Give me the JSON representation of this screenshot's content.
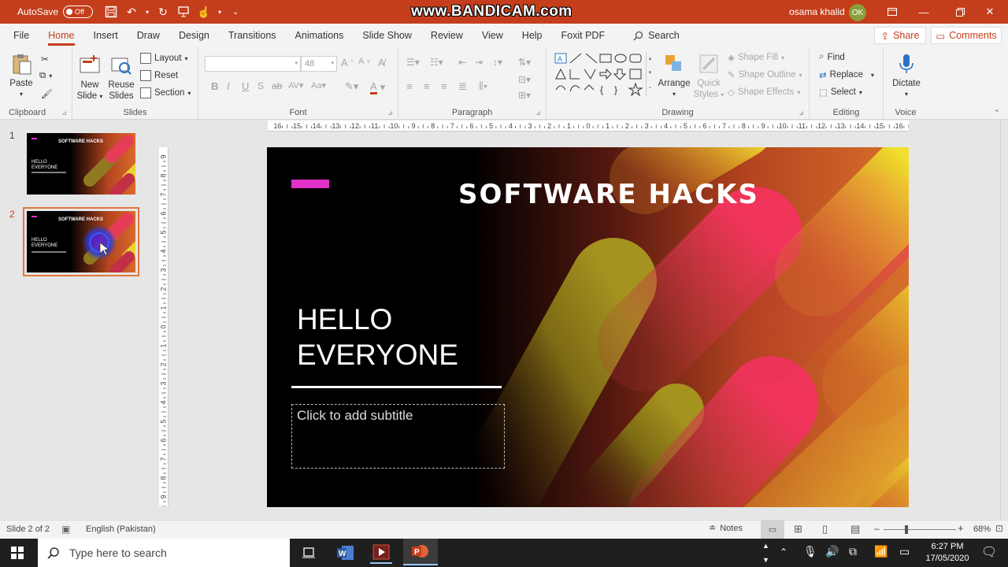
{
  "titlebar": {
    "autosave_label": "AutoSave",
    "autosave_state": "Off",
    "watermark": "www.BANDICAM.com",
    "user_name": "osama khalid",
    "user_initials": "OK"
  },
  "tabs": [
    "File",
    "Home",
    "Insert",
    "Draw",
    "Design",
    "Transitions",
    "Animations",
    "Slide Show",
    "Review",
    "View",
    "Help",
    "Foxit PDF"
  ],
  "active_tab": "Home",
  "search_label": "Search",
  "share_label": "Share",
  "comments_label": "Comments",
  "ribbon": {
    "clipboard": {
      "label": "Clipboard",
      "paste": "Paste"
    },
    "slides": {
      "label": "Slides",
      "new_slide_1": "New",
      "new_slide_2": "Slide",
      "reuse_1": "Reuse",
      "reuse_2": "Slides",
      "layout": "Layout",
      "reset": "Reset",
      "section": "Section"
    },
    "font": {
      "label": "Font",
      "font_size": "48"
    },
    "paragraph": {
      "label": "Paragraph"
    },
    "drawing": {
      "label": "Drawing",
      "arrange": "Arrange",
      "quick_styles_1": "Quick",
      "quick_styles_2": "Styles",
      "shape_fill": "Shape Fill",
      "shape_outline": "Shape Outline",
      "shape_effects": "Shape Effects"
    },
    "editing": {
      "label": "Editing",
      "find": "Find",
      "replace": "Replace",
      "select": "Select"
    },
    "voice": {
      "label": "Voice",
      "dictate": "Dictate"
    }
  },
  "thumbnails": [
    {
      "number": "1",
      "title": "SOFTWARE HACKS",
      "line1": "HELLO",
      "line2": "EVERYONE"
    },
    {
      "number": "2",
      "title": "SOFTWARE HACKS",
      "line1": "HELLO",
      "line2": "EVERYONE"
    }
  ],
  "slide": {
    "title": "SOFTWARE HACKS",
    "heading_line1": "HELLO",
    "heading_line2": "EVERYONE",
    "subtitle_placeholder": "Click to add subtitle"
  },
  "hruler_labels": [
    "16",
    "15",
    "14",
    "13",
    "12",
    "11",
    "10",
    "9",
    "8",
    "7",
    "6",
    "5",
    "4",
    "3",
    "2",
    "1",
    "0",
    "1",
    "2",
    "3",
    "4",
    "5",
    "6",
    "7",
    "8",
    "9",
    "10",
    "11",
    "12",
    "13",
    "14",
    "15",
    "16"
  ],
  "vruler_labels": [
    "9",
    "8",
    "7",
    "6",
    "5",
    "4",
    "3",
    "2",
    "1",
    "0",
    "1",
    "2",
    "3",
    "4",
    "5",
    "6",
    "7",
    "8",
    "9"
  ],
  "status": {
    "slide_info": "Slide 2 of 2",
    "language": "English (Pakistan)",
    "notes": "Notes",
    "zoom": "68%"
  },
  "taskbar": {
    "search_placeholder": "Type here to search",
    "time": "6:27 PM",
    "date": "17/05/2020"
  }
}
